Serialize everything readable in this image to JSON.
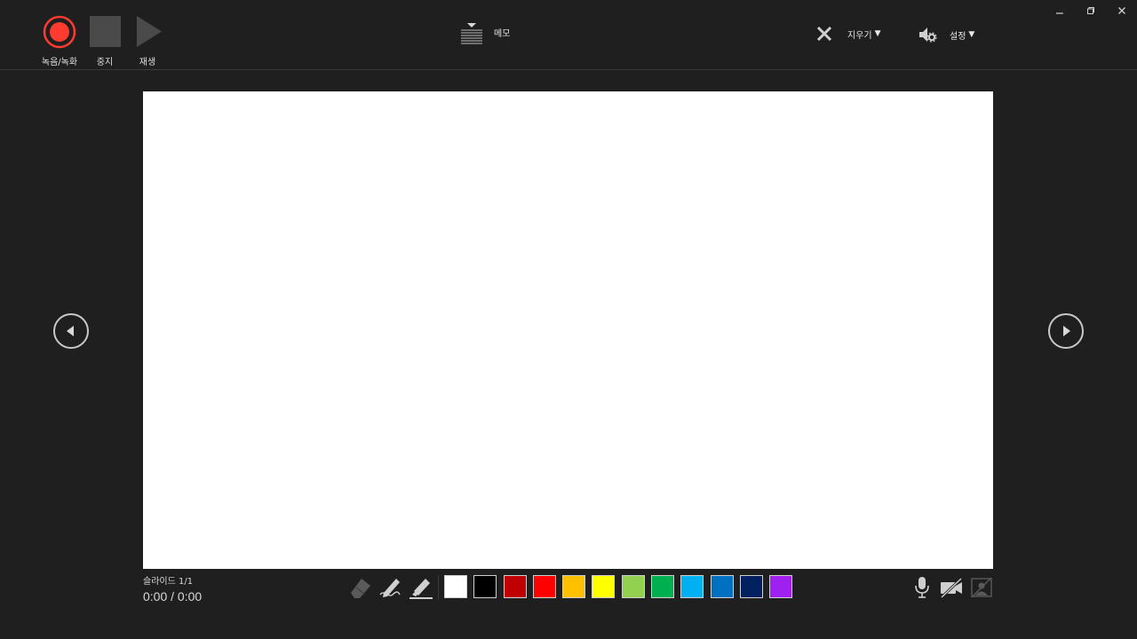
{
  "toolbar": {
    "record_label": "녹음/녹화",
    "stop_label": "중지",
    "play_label": "재생",
    "notes_label": "메모",
    "clear_label": "지우기",
    "settings_label": "설정"
  },
  "status": {
    "slide_counter": "슬라이드 1/1",
    "time": "0:00 / 0:00"
  },
  "ink": {
    "tools": [
      "eraser-icon",
      "pen-icon",
      "highlighter-icon"
    ],
    "colors": [
      "#ffffff",
      "#000000",
      "#c00000",
      "#ff0000",
      "#ffc000",
      "#ffff00",
      "#92d050",
      "#00b050",
      "#00b0f0",
      "#0070c0",
      "#002060",
      "#a020f0"
    ]
  },
  "colors": {
    "record": "#ff3b30",
    "background": "#1f1f1f",
    "slide": "#ffffff"
  }
}
